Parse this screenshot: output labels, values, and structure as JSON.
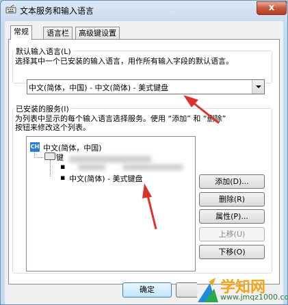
{
  "window": {
    "title": "文本服务和输入语言",
    "close_symbol": "x"
  },
  "tabs": [
    {
      "label": "常规",
      "active": true
    },
    {
      "label": "语言栏",
      "active": false
    },
    {
      "label": "高级键设置",
      "active": false
    }
  ],
  "default_language": {
    "group_label": "默认输入语言(L)",
    "description": "选择其中一个已安装的输入语言，用作所有输入字段的默认语言。",
    "selected": "中文(简体，中国) - 中文(简体) - 美式键盘"
  },
  "installed_services": {
    "group_label": "已安装的服务(I)",
    "description_line1": "为列表中显示的每个输入语言选择服务。使用 “添加” 和 “删除”",
    "description_line2": "按钮来修改这个列表。",
    "tree": {
      "language": "中文(简体，中国)",
      "language_icon": "CH",
      "category": "键",
      "item": "中文(简体) - 美式键盘"
    }
  },
  "buttons": {
    "add": "添加(D)...",
    "remove": "删除(R)",
    "properties": "属性(P)...",
    "move_up": "上移(U)",
    "move_down": "下移(O)",
    "ok": "确定"
  },
  "watermark": {
    "text": "学知网",
    "url": "www.jmqz1000.com"
  },
  "colors": {
    "annotation_arrow": "#e0302a",
    "watermark_text": "#f0a51a"
  }
}
